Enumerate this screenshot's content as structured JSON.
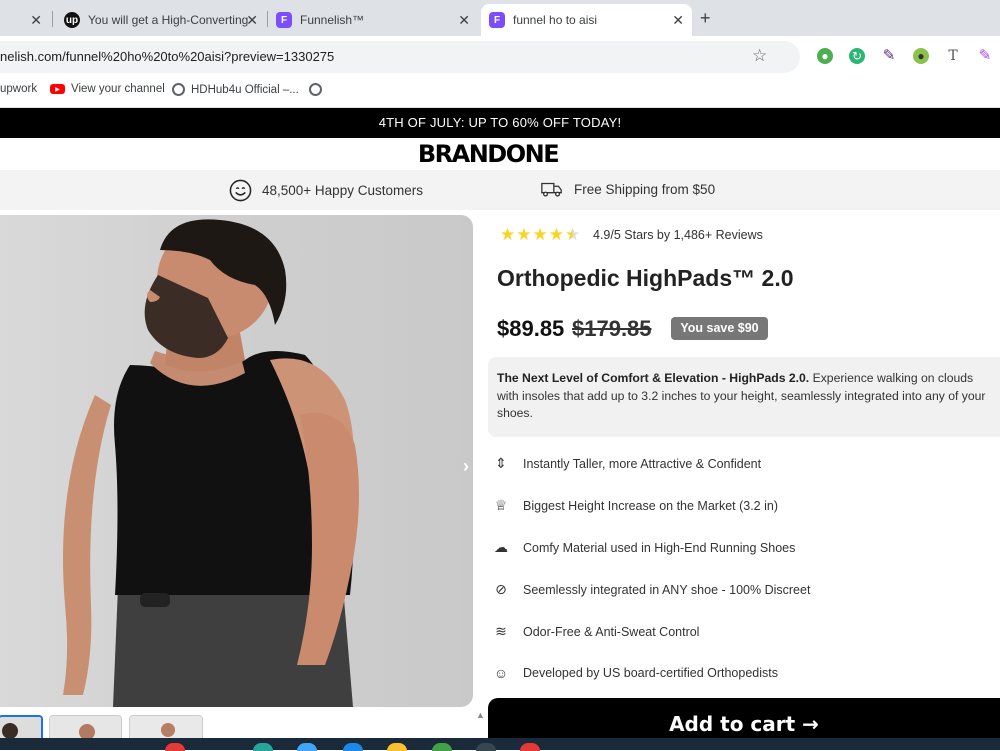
{
  "browser": {
    "tabs": [
      {
        "label": "",
        "favicon": "",
        "active": false
      },
      {
        "label": "You will get a High-Converting",
        "favicon": "up",
        "active": false
      },
      {
        "label": "Funnelish™",
        "favicon": "F",
        "active": false
      },
      {
        "label": "funnel ho to aisi",
        "favicon": "F",
        "active": true
      }
    ],
    "new_tab": "+",
    "close_glyph": "✕",
    "url": "nelish.com/funnel%20ho%20to%20aisi?preview=1330275",
    "bookmarks": [
      {
        "label": "upwork",
        "icon": "upwork-icon"
      },
      {
        "label": "View your channel",
        "icon": "youtube-icon"
      },
      {
        "label": "HDHub4u Official –...",
        "icon": "globe-icon"
      },
      {
        "label": "",
        "icon": "globe-icon"
      }
    ],
    "extensions": [
      "globe-ext-icon",
      "refresh-ext-icon",
      "eyedropper-icon",
      "lightbulb-icon",
      "text-t-icon",
      "pen-icon"
    ]
  },
  "store": {
    "announcement": "4TH OF JULY: UP TO 60% OFF TODAY!",
    "logo": "BRANDONE",
    "trust": {
      "customers": "48,500+ Happy Customers",
      "shipping": "Free Shipping from $50"
    },
    "product": {
      "rating_text": "4.9/5 Stars by 1,486+ Reviews",
      "stars": 4.5,
      "title": "Orthopedic HighPads™ 2.0",
      "price": "$89.85",
      "old_price": "$179.85",
      "save_badge": "You save $90",
      "description_bold": "The Next Level of Comfort & Elevation - HighPads 2.0.",
      "description_rest": " Experience walking on clouds with insoles that add up to 3.2 inches to your height, seamlessly integrated into any of your shoes.",
      "features": [
        {
          "icon": "height-icon",
          "text": "Instantly Taller, more Attractive & Confident"
        },
        {
          "icon": "trophy-icon",
          "text": "Biggest Height Increase on the Market (3.2 in)"
        },
        {
          "icon": "cloud-icon",
          "text": "Comfy Material used in High-End Running Shoes"
        },
        {
          "icon": "eye-off-icon",
          "text": "Seemlessly integrated in ANY shoe - 100% Discreet"
        },
        {
          "icon": "wind-icon",
          "text": "Odor-Free & Anti-Sweat Control"
        },
        {
          "icon": "head-icon",
          "text": "Developed by US board-certified Orthopedists"
        }
      ],
      "cta": "Add to cart →",
      "gallery_next": "›"
    }
  },
  "colors": {
    "accent": "#7c4dff",
    "star": "#f9d423",
    "badge": "#777777",
    "cta_bg": "#000000"
  }
}
